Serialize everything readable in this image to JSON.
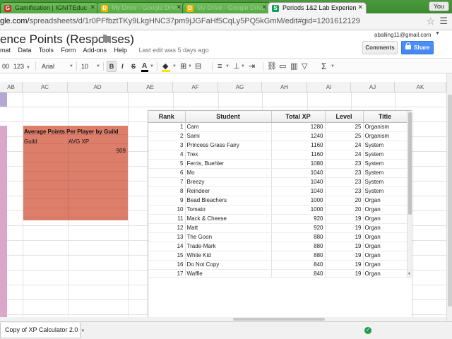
{
  "browser": {
    "tabs": [
      {
        "label": "Gamification | IGNITEduc",
        "icon": "G"
      },
      {
        "label": "My Drive - Google Drive",
        "icon": "D"
      },
      {
        "label": "My Drive - Google Drive",
        "icon": "D"
      },
      {
        "label": "Periods 1&2 Lab Experien",
        "icon": "S"
      }
    ],
    "profile": "You",
    "url_prefix": "gle.com/",
    "url_rest": "spreadsheets/d/1r0PFfbztTKy9LkgHNC37pm9jJGFaHf5CqLy5PQ5kGmM/edit#gid=1201612129"
  },
  "doc": {
    "title": "ence Points (Responses)",
    "user_email": "aballing11@gmail.com",
    "comments_label": "Comments",
    "share_label": "Share",
    "menus": [
      "mat",
      "Data",
      "Tools",
      "Form",
      "Add-ons",
      "Help"
    ],
    "last_edit": "Last edit was 5 days ago"
  },
  "toolbar": {
    "number_format": "00",
    "format_123": "123",
    "font": "Arial",
    "font_size": "10",
    "bold": "B",
    "italic": "I",
    "strike": "S",
    "text_color": "A"
  },
  "columns": [
    "AB",
    "AC",
    "AD",
    "AE",
    "AF",
    "AG",
    "AH",
    "AI",
    "AJ",
    "AK"
  ],
  "guild_block": {
    "title": "Average Points Per Player by Guild",
    "col1": "Guild",
    "col2": "AVG XP",
    "value": "909"
  },
  "leaderboard": {
    "headers": [
      "Rank",
      "Student",
      "Total XP",
      "Level",
      "Title"
    ],
    "rows": [
      [
        "1",
        "Cam",
        "1280",
        "25",
        "Organism"
      ],
      [
        "2",
        "Sami",
        "1240",
        "25",
        "Organism"
      ],
      [
        "3",
        "Princess Grass Fairy",
        "1160",
        "24",
        "System"
      ],
      [
        "4",
        "Trex",
        "1160",
        "24",
        "System"
      ],
      [
        "5",
        "Ferris, Buehler",
        "1080",
        "23",
        "System"
      ],
      [
        "6",
        "Mo",
        "1040",
        "23",
        "System"
      ],
      [
        "7",
        "Breezy",
        "1040",
        "23",
        "System"
      ],
      [
        "8",
        "Reindeer",
        "1040",
        "23",
        "System"
      ],
      [
        "9",
        "Bead Bleachers",
        "1000",
        "20",
        "Organ"
      ],
      [
        "10",
        "Tomato",
        "1000",
        "20",
        "Organ"
      ],
      [
        "11",
        "Mack & Cheese",
        "920",
        "19",
        "Organ"
      ],
      [
        "12",
        "Matt",
        "920",
        "19",
        "Organ"
      ],
      [
        "13",
        "The Goon",
        "880",
        "19",
        "Organ"
      ],
      [
        "14",
        "Trade-Mark",
        "880",
        "19",
        "Organ"
      ],
      [
        "15",
        "White Kid",
        "880",
        "19",
        "Organ"
      ],
      [
        "16",
        "Do Not Copy",
        "840",
        "19",
        "Organ"
      ],
      [
        "17",
        "Waffle",
        "840",
        "19",
        "Organ"
      ]
    ]
  },
  "sheet_tab": "Copy of XP Calculator 2.0",
  "colors": {
    "accent_orange": "#dd7e6b",
    "pink_column": "#d8a7c9",
    "share_blue": "#4d90fe",
    "saved_green": "#1e9e4a"
  }
}
